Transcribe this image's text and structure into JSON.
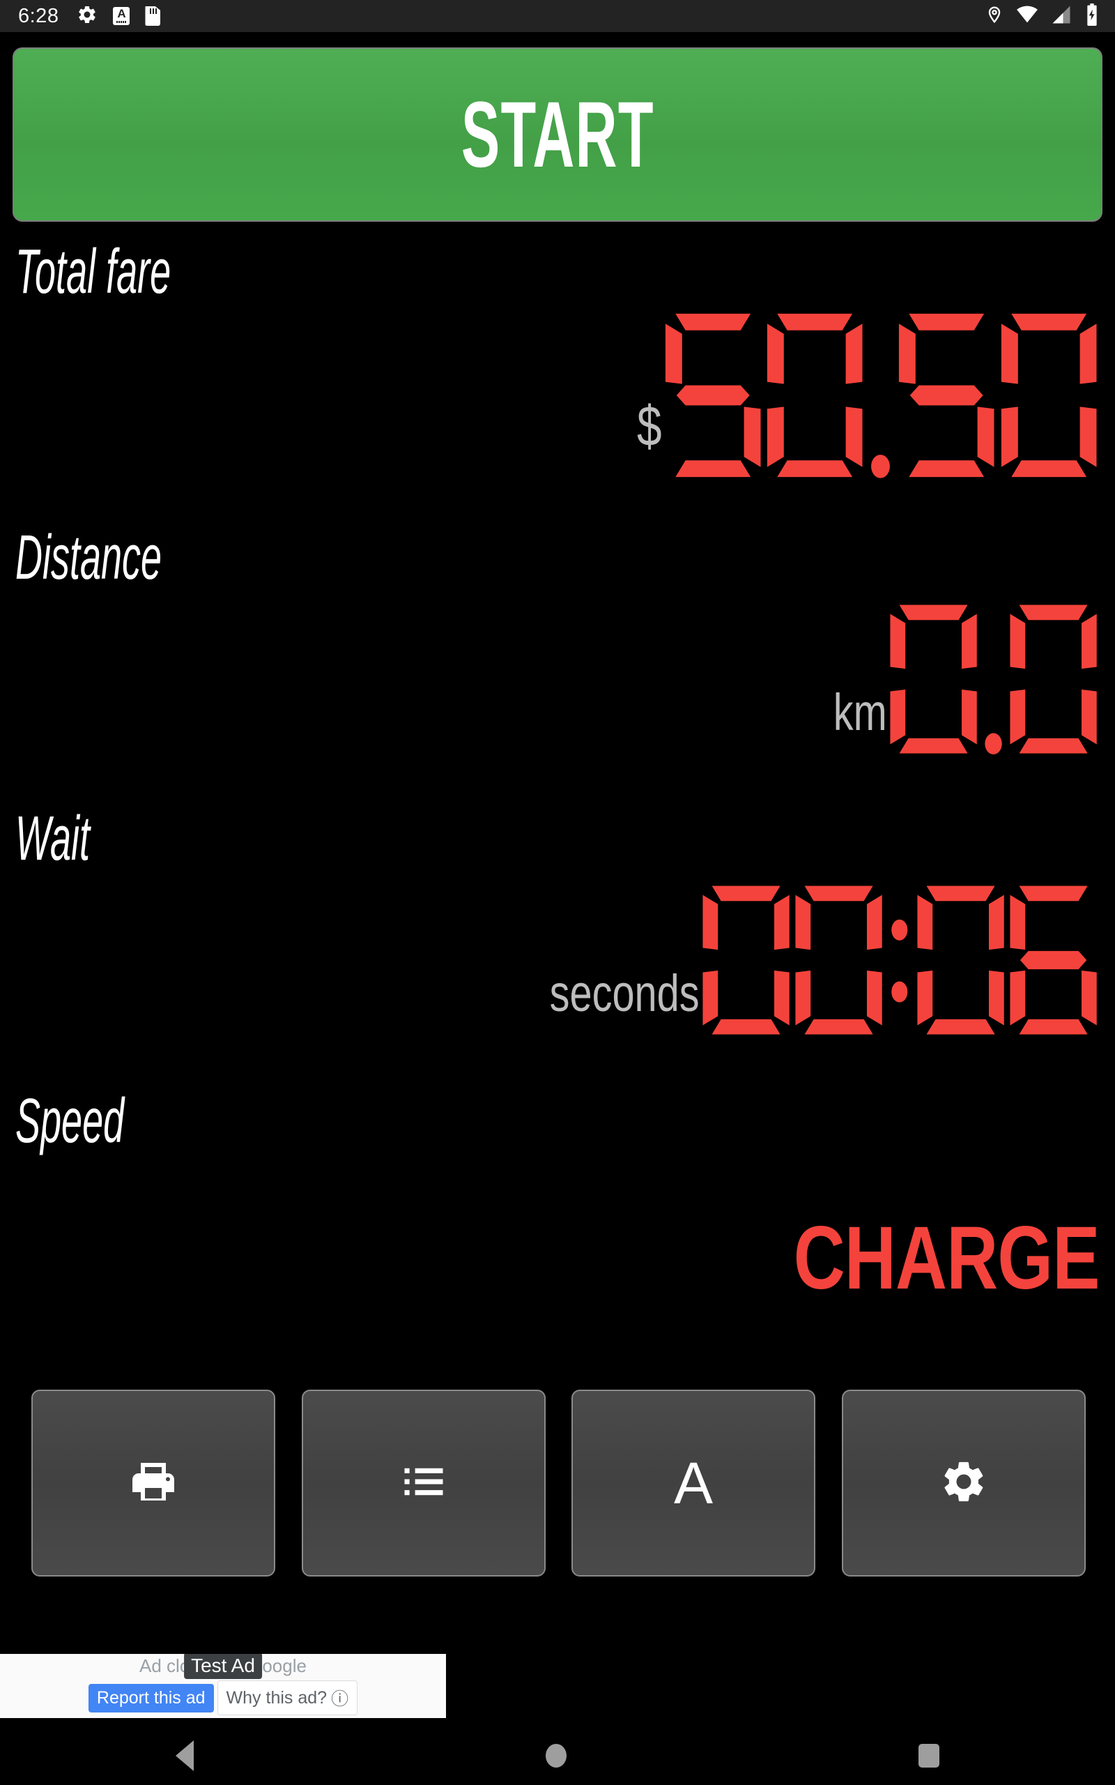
{
  "statusbar": {
    "clock": "6:28",
    "left_icons": [
      "gear-icon",
      "android-auto-icon",
      "sdcard-icon"
    ],
    "right_icons": [
      "location-icon",
      "wifi-icon",
      "signal-icon",
      "battery-charging-icon"
    ],
    "android_auto_letter": "A"
  },
  "start_button": {
    "label": "START",
    "color": "#43a047",
    "text_color": "#ffffff"
  },
  "metrics": [
    {
      "label": "Total fare",
      "unit": "$",
      "unit_position": "prefix",
      "value": "50.50",
      "display_type": "seven-segment",
      "color": "#f4433c"
    },
    {
      "label": "Distance",
      "unit": "km",
      "unit_position": "prefix",
      "value": "0.0",
      "display_type": "seven-segment",
      "color": "#f4433c"
    },
    {
      "label": "Wait",
      "unit": "seconds",
      "unit_position": "prefix",
      "value": "00:06",
      "display_type": "seven-segment",
      "color": "#f4433c"
    },
    {
      "label": "Speed",
      "unit": "",
      "unit_position": "prefix",
      "value": "CHARGE",
      "display_type": "text",
      "color": "#f4433c"
    }
  ],
  "toolbar": {
    "buttons": [
      {
        "name": "print-button",
        "icon": "printer-icon",
        "label": ""
      },
      {
        "name": "list-button",
        "icon": "list-icon",
        "label": ""
      },
      {
        "name": "tariff-a-button",
        "icon": "letter-a",
        "label": "A"
      },
      {
        "name": "settings-button",
        "icon": "gear-icon",
        "label": ""
      }
    ]
  },
  "ad": {
    "closed_text": "Ad closed by Google",
    "test_badge": "Test Ad",
    "report_label": "Report this ad",
    "why_label": "Why this ad?",
    "info_icon": "ⓘ",
    "blue": "#4285f4"
  },
  "navbar": {
    "back": "back-icon",
    "home": "home-icon",
    "recents": "recents-icon"
  },
  "colors": {
    "background": "#000000",
    "led_red": "#f4433c",
    "unit_gray": "#bdbdbd",
    "label_white": "#ffffff",
    "button_gray": "#454545"
  }
}
